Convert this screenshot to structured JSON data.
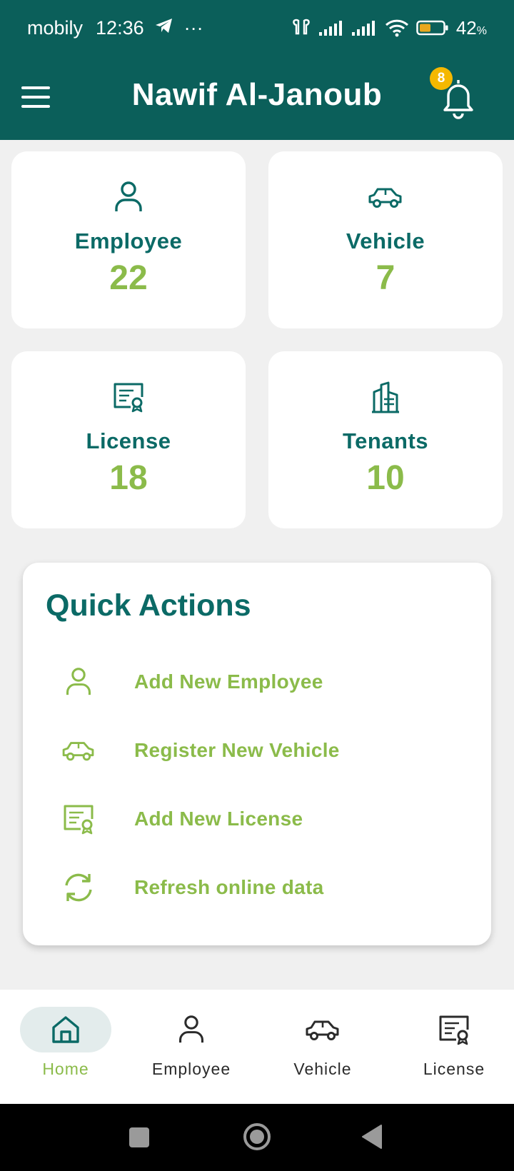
{
  "status_bar": {
    "carrier": "mobily",
    "time": "12:36",
    "more": "···",
    "battery_percent": "42",
    "battery_unit": "%"
  },
  "header": {
    "title": "Nawif Al-Janoub",
    "notification_count": "8"
  },
  "stats": [
    {
      "label": "Employee",
      "value": "22",
      "icon": "person-icon"
    },
    {
      "label": "Vehicle",
      "value": "7",
      "icon": "car-icon"
    },
    {
      "label": "License",
      "value": "18",
      "icon": "certificate-icon"
    },
    {
      "label": "Tenants",
      "value": "10",
      "icon": "building-icon"
    }
  ],
  "quick_actions": {
    "title": "Quick Actions",
    "items": [
      {
        "label": "Add New Employee",
        "icon": "person-icon"
      },
      {
        "label": "Register New Vehicle",
        "icon": "car-icon"
      },
      {
        "label": "Add New License",
        "icon": "certificate-icon"
      },
      {
        "label": "Refresh online data",
        "icon": "refresh-icon"
      }
    ]
  },
  "bottom_nav": {
    "active": "Home",
    "items": [
      {
        "label": "Home",
        "icon": "home-icon"
      },
      {
        "label": "Employee",
        "icon": "person-icon"
      },
      {
        "label": "Vehicle",
        "icon": "car-icon"
      },
      {
        "label": "License",
        "icon": "certificate-icon"
      }
    ]
  },
  "colors": {
    "primary": "#0b5f5a",
    "title_teal": "#0b6a66",
    "accent_green": "#8bbb4a",
    "badge": "#f5b800",
    "background": "#f0f0f0"
  }
}
